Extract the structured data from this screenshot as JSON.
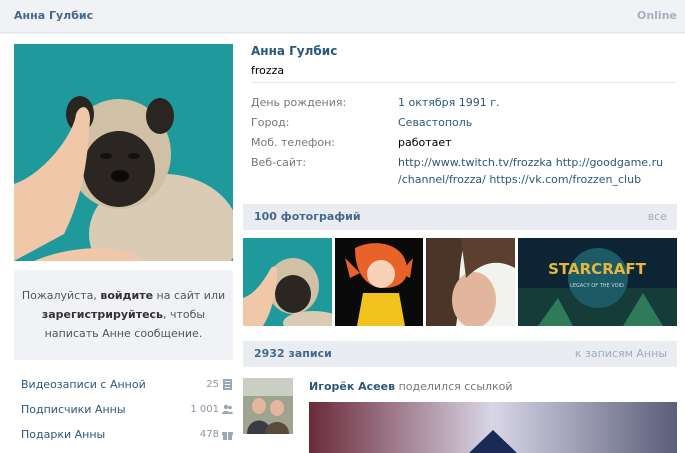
{
  "header": {
    "name": "Анна Гулбис",
    "online": "Online"
  },
  "profile": {
    "name": "Анна Гулбис",
    "status": "frozza",
    "info": [
      {
        "label": "День рождения:",
        "value": "1 октября 1991 г."
      },
      {
        "label": "Город:",
        "value": "Севастополь"
      },
      {
        "label": "Моб. телефон:",
        "value": "работает"
      },
      {
        "label": "Веб-сайт:",
        "value": "http://www.twitch.tv/frozzka http://goodgame.ru /channel/frozza/  https://vk.com/frozzen_club"
      }
    ]
  },
  "login_box": {
    "line1_pre": "Пожалуйста, ",
    "login": "войдите",
    "line1_post": " на сайт или",
    "register": "зарегистрируйтесь",
    "line2_post": ", чтобы",
    "line3": "написать Анне сообщение."
  },
  "left_links": [
    {
      "label": "Видеозаписи с Анной",
      "count": "25",
      "icon": "video-icon"
    },
    {
      "label": "Подписчики Анны",
      "count": "1 001",
      "icon": "followers-icon"
    },
    {
      "label": "Подарки Анны",
      "count": "478",
      "icon": "gift-icon"
    }
  ],
  "photos_section": {
    "title": "100 фотографий",
    "link": "все"
  },
  "wall_section": {
    "title": "2932 записи",
    "link": "к записям Анны"
  },
  "post": {
    "author": "Игорёк Асеев",
    "action": "поделился ссылкой"
  },
  "colors": {
    "link": "#2b587a",
    "header_bg": "#e9edf1",
    "avatar_bg": "#1f9a9c"
  }
}
